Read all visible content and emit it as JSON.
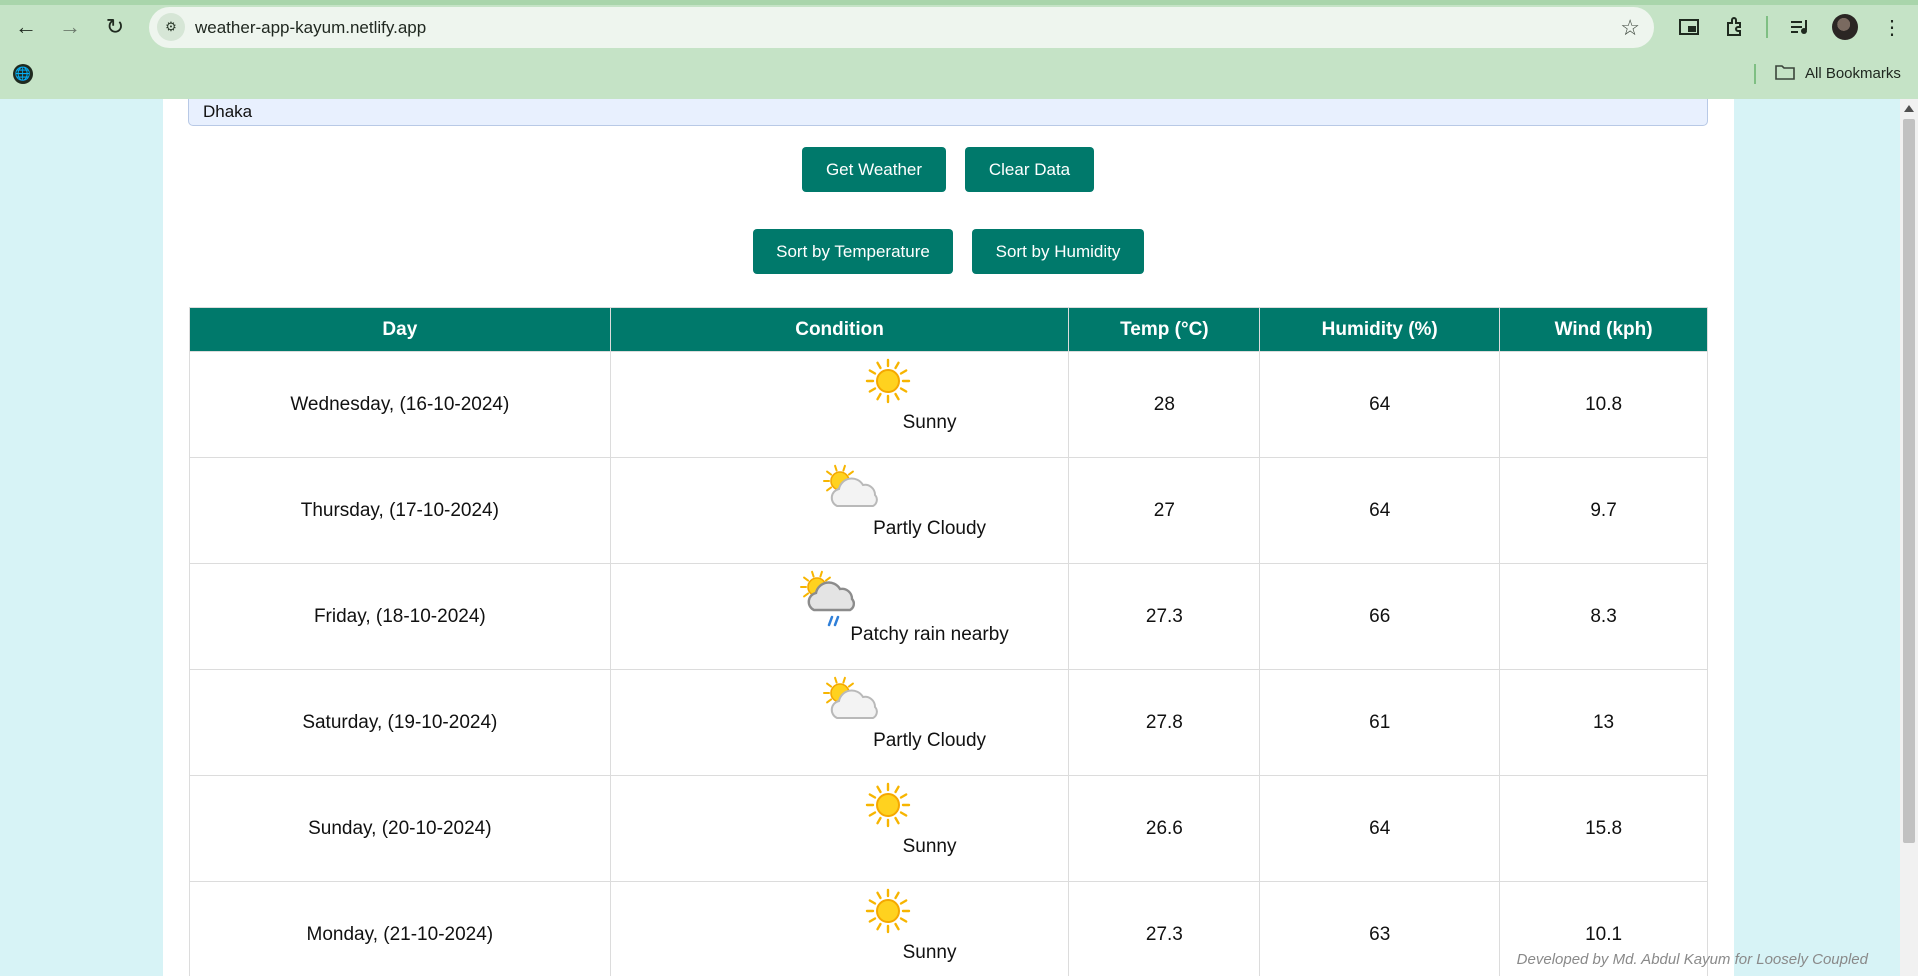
{
  "browser": {
    "url": "weather-app-kayum.netlify.app",
    "bookmarks_label": "All Bookmarks",
    "icons": [
      "back-arrow-icon",
      "forward-arrow-icon",
      "reload-icon",
      "site-info-icon",
      "bookmark-star-icon",
      "picture-in-picture-icon",
      "extensions-icon",
      "media-control-icon",
      "profile-avatar",
      "more-menu-icon",
      "globe-icon",
      "folder-icon"
    ]
  },
  "app": {
    "city_value": "Dhaka",
    "buttons": {
      "get_weather": "Get Weather",
      "clear_data": "Clear Data",
      "sort_temperature": "Sort by Temperature",
      "sort_humidity": "Sort by Humidity"
    },
    "accent_color": "#00796b",
    "table": {
      "headers": {
        "day": "Day",
        "condition": "Condition",
        "temp": "Temp (°C)",
        "humidity": "Humidity (%)",
        "wind": "Wind (kph)"
      },
      "rows": [
        {
          "day": "Wednesday, (16-10-2024)",
          "condition": "Sunny",
          "icon": "sunny-icon",
          "temp": "28",
          "humidity": "64",
          "wind": "10.8"
        },
        {
          "day": "Thursday, (17-10-2024)",
          "condition": "Partly Cloudy",
          "icon": "partly-cloudy-icon",
          "temp": "27",
          "humidity": "64",
          "wind": "9.7"
        },
        {
          "day": "Friday, (18-10-2024)",
          "condition": "Patchy rain nearby",
          "icon": "patchy-rain-icon",
          "temp": "27.3",
          "humidity": "66",
          "wind": "8.3"
        },
        {
          "day": "Saturday, (19-10-2024)",
          "condition": "Partly Cloudy",
          "icon": "partly-cloudy-icon",
          "temp": "27.8",
          "humidity": "61",
          "wind": "13"
        },
        {
          "day": "Sunday, (20-10-2024)",
          "condition": "Sunny",
          "icon": "sunny-icon",
          "temp": "26.6",
          "humidity": "64",
          "wind": "15.8"
        },
        {
          "day": "Monday, (21-10-2024)",
          "condition": "Sunny",
          "icon": "sunny-icon",
          "temp": "27.3",
          "humidity": "63",
          "wind": "10.1"
        }
      ]
    },
    "footer_credit": "Developed by Md. Abdul Kayum for Loosely Coupled"
  }
}
